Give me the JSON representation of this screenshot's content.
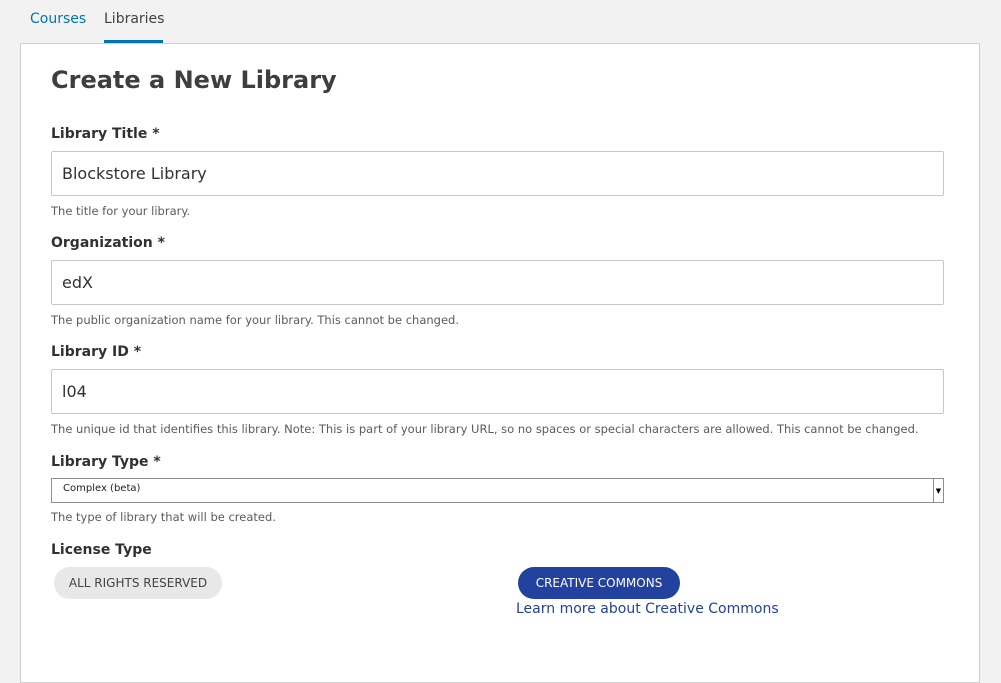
{
  "tabs": [
    {
      "label": "Courses",
      "active": false
    },
    {
      "label": "Libraries",
      "active": true
    }
  ],
  "form": {
    "title": "Create a New Library",
    "library_title": {
      "label": "Library Title *",
      "value": "Blockstore Library",
      "help": "The title for your library."
    },
    "organization": {
      "label": "Organization *",
      "value": "edX",
      "help": "The public organization name for your library. This cannot be changed."
    },
    "library_id": {
      "label": "Library ID *",
      "value": "l04",
      "help": "The unique id that identifies this library. Note: This is part of your library URL, so no spaces or special characters are allowed. This cannot be changed."
    },
    "library_type": {
      "label": "Library Type *",
      "selected": "Complex (beta)",
      "help": "The type of library that will be created."
    },
    "license_type": {
      "label": "License Type",
      "options": [
        "ALL RIGHTS RESERVED",
        "CREATIVE COMMONS"
      ],
      "selected": "CREATIVE COMMONS",
      "link": "Learn more about Creative Commons"
    }
  },
  "colors": {
    "accent": "#0075b4",
    "primary_button": "#23419f",
    "background": "#f2f2f2"
  }
}
